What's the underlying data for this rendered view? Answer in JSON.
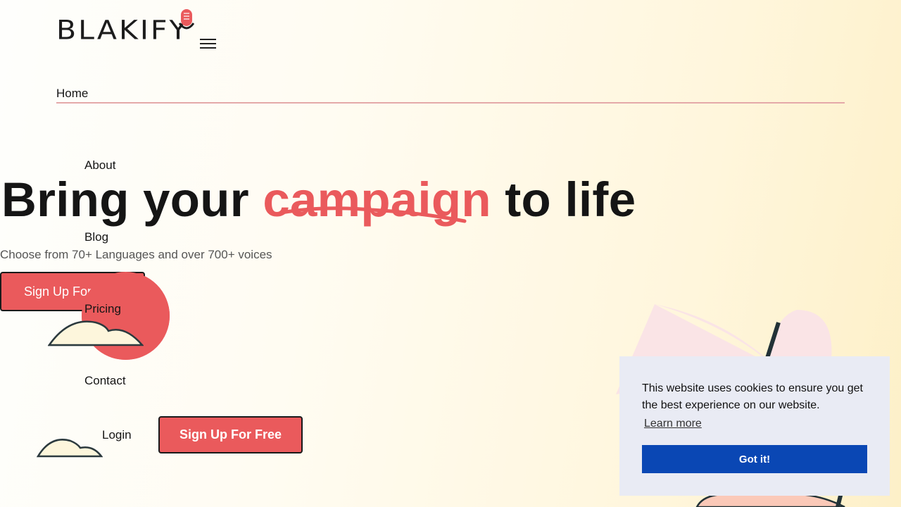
{
  "header": {
    "logo_text": "BLAKIFY",
    "menu_icon": "hamburger-icon"
  },
  "nav": {
    "items": [
      {
        "label": "Home"
      },
      {
        "label": "About"
      },
      {
        "label": "Blog"
      },
      {
        "label": "Pricing"
      },
      {
        "label": "Contact"
      }
    ],
    "login_label": "Login",
    "signup_label": "Sign Up For Free"
  },
  "hero": {
    "title_before": "Bring your ",
    "title_accent": "campaign",
    "title_after": " to life",
    "subtitle": "Choose from 70+ Languages and over 700+ voices",
    "cta_label": "Sign Up For Free"
  },
  "cookie_banner": {
    "message": "This website uses cookies to ensure you get the best experience on our website.",
    "learn_more_label": "Learn more",
    "accept_label": "Got it!"
  },
  "colors": {
    "accent": "#ea5a5c",
    "cookie_button": "#0a47b4",
    "cookie_background": "#e9ebf4"
  }
}
